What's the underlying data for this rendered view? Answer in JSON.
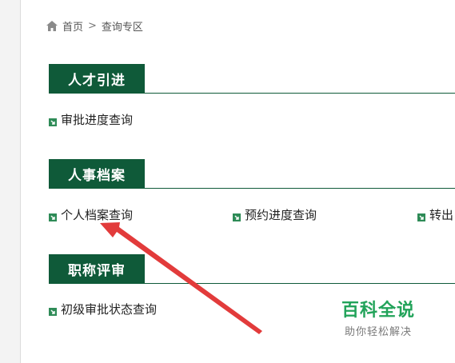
{
  "breadcrumb": {
    "home": "首页",
    "separator": ">",
    "current": "查询专区"
  },
  "sections": [
    {
      "title": "人才引进",
      "links": [
        "审批进度查询"
      ]
    },
    {
      "title": "人事档案",
      "links": [
        "个人档案查询",
        "预约进度查询",
        "转出"
      ]
    },
    {
      "title": "职称评审",
      "links": [
        "初级审批状态查询"
      ]
    }
  ],
  "watermark": {
    "title": "百科全说",
    "subtitle": "助你轻松解决"
  },
  "colors": {
    "section_green": "#0f5a39",
    "bullet_green": "#2e8b57",
    "arrow_red": "#e23b3b",
    "watermark_green": "#22a35a"
  }
}
